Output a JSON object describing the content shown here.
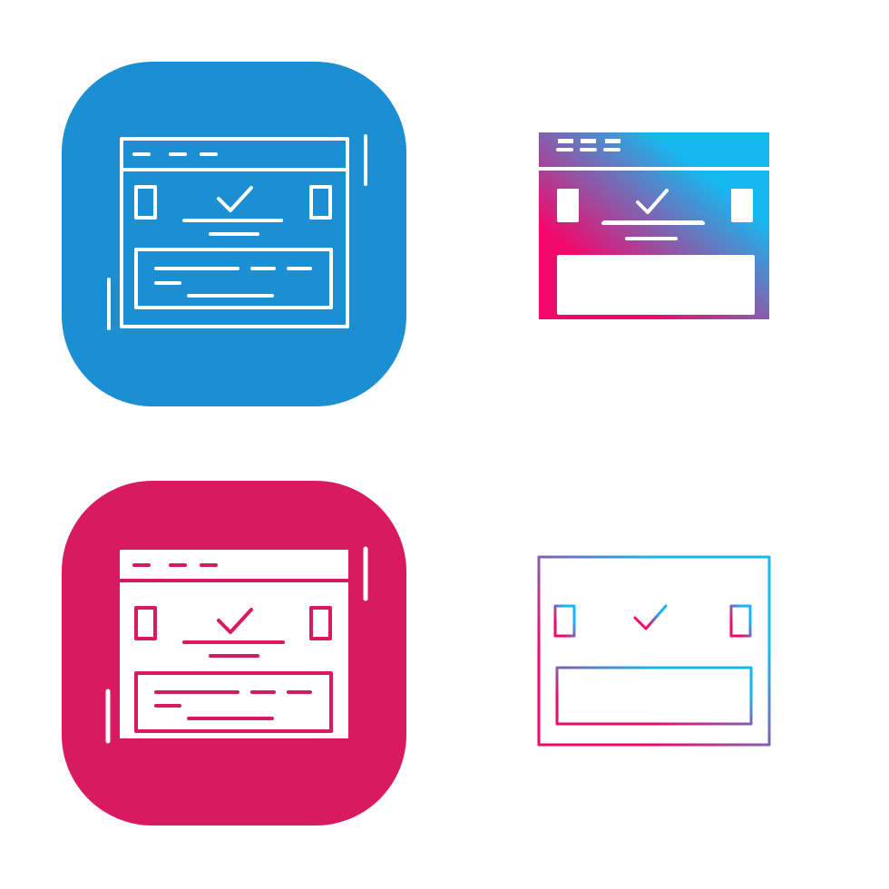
{
  "icons": [
    {
      "style": "line-on-rounded-square",
      "icon": "browser-confirmation-icon",
      "tile_color": "#1b8fd2",
      "stroke_color": "#ffffff"
    },
    {
      "style": "gradient-glyph",
      "icon": "browser-confirmation-icon",
      "gradient": [
        "#f2086b",
        "#16b8f0"
      ]
    },
    {
      "style": "glyph-on-rounded-square",
      "icon": "browser-confirmation-icon",
      "tile_color": "#d91a63",
      "glyph_color": "#ffffff"
    },
    {
      "style": "gradient-line",
      "icon": "browser-confirmation-icon",
      "gradient": [
        "#f2086b",
        "#16b8f0"
      ]
    }
  ]
}
